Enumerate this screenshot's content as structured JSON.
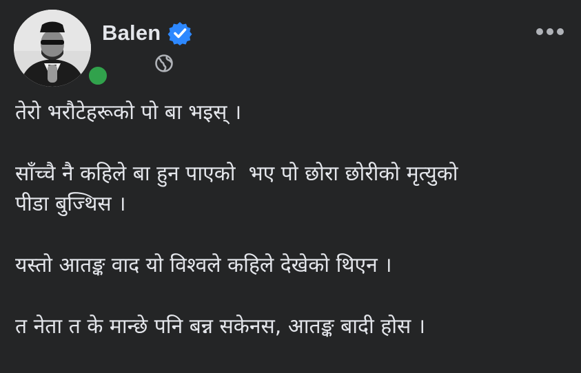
{
  "author": {
    "name": "Balen",
    "verified": true,
    "online": true
  },
  "icons": {
    "verified": "verified-badge-icon",
    "privacy": "globe-icon",
    "more": "more-options-icon"
  },
  "colors": {
    "background": "#242526",
    "text": "#e4e6eb",
    "verified": "#2d88ff",
    "online": "#31a24c"
  },
  "post": {
    "paragraphs": [
      "तेरो भरौटेहरूको पो बा भइस् ।",
      "साँच्चै नै कहिले बा हुन पाएको  भए पो छोरा छोरीको मृत्युको\nपीडा बुज्थिस ।",
      "यस्तो आतङ्क वाद यो विश्वले कहिले देखेको थिएन ।",
      "त नेता त के मान्छे पनि बन्न सकेनस, आतङ्क बादी होस ।"
    ]
  }
}
